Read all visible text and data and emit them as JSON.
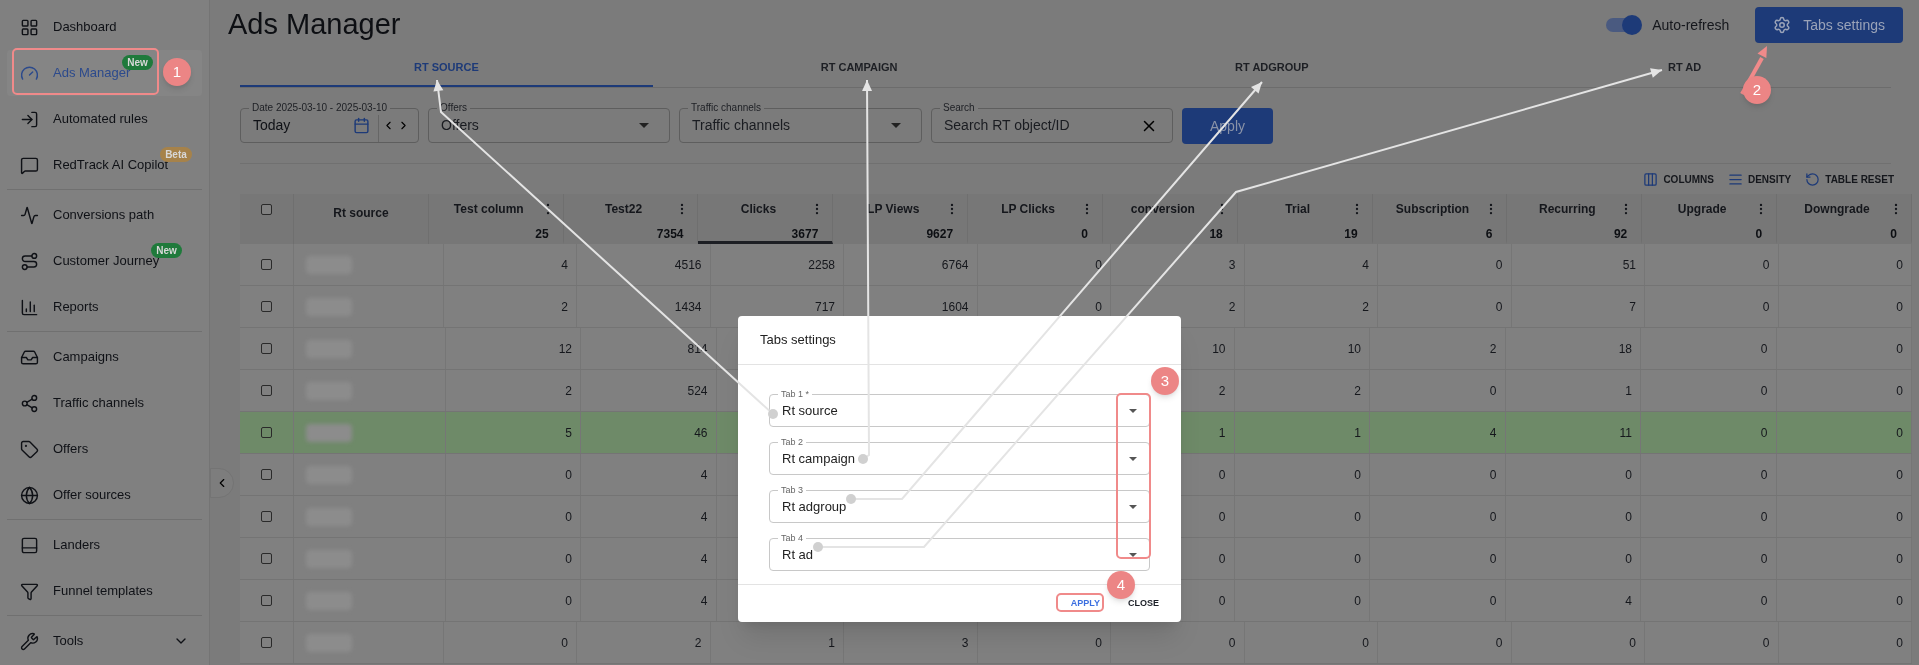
{
  "sidebar": {
    "groups": [
      {
        "items": [
          {
            "label": "Dashboard",
            "selected": false
          },
          {
            "label": "Ads Manager",
            "selected": true,
            "badge": {
              "text": "New",
              "color": "#1f7a3b"
            }
          },
          {
            "label": "Automated rules",
            "selected": false
          },
          {
            "label": "RedTrack AI Copilot",
            "selected": false,
            "badge": {
              "text": "Beta",
              "color": "#a6824a"
            }
          }
        ]
      },
      {
        "items": [
          {
            "label": "Conversions path",
            "selected": false
          },
          {
            "label": "Customer Journey",
            "selected": false,
            "badge": {
              "text": "New",
              "color": "#1f7a3b"
            }
          },
          {
            "label": "Reports",
            "selected": false
          }
        ]
      },
      {
        "items": [
          {
            "label": "Campaigns",
            "selected": false
          },
          {
            "label": "Traffic channels",
            "selected": false
          },
          {
            "label": "Offers",
            "selected": false
          },
          {
            "label": "Offer sources",
            "selected": false
          }
        ]
      },
      {
        "items": [
          {
            "label": "Landers",
            "selected": false
          },
          {
            "label": "Funnel templates",
            "selected": false
          }
        ]
      },
      {
        "items": [
          {
            "label": "Tools",
            "selected": false,
            "expanded": false
          }
        ]
      }
    ]
  },
  "page_title": "Ads Manager",
  "auto_refresh": {
    "label": "Auto-refresh",
    "on": true
  },
  "settings_button": "Tabs settings",
  "tabs": [
    {
      "label": "RT SOURCE",
      "selected": true
    },
    {
      "label": "RT CAMPAIGN",
      "selected": false
    },
    {
      "label": "RT ADGROUP",
      "selected": false
    },
    {
      "label": "RT AD",
      "selected": false
    }
  ],
  "filters": {
    "date": {
      "label": "Date 2025-03-10 - 2025-03-10",
      "value": "Today"
    },
    "offers": {
      "label": "Offers",
      "placeholder": "Offers"
    },
    "traffic_channels": {
      "label": "Traffic channels",
      "placeholder": "Traffic channels"
    },
    "search": {
      "label": "Search",
      "placeholder": "Search RT object/ID"
    },
    "apply": "Apply"
  },
  "toolbar": [
    "COLUMNS",
    "DENSITY",
    "TABLE RESET"
  ],
  "table": {
    "all_checked": false,
    "source_column": {
      "label": "Rt source"
    },
    "columns": [
      {
        "label": "Test column",
        "total": "25",
        "sorted": false
      },
      {
        "label": "Test22",
        "total": "7354",
        "sorted": false
      },
      {
        "label": "Clicks",
        "total": "3677",
        "sorted": true
      },
      {
        "label": "LP Views",
        "total": "9627",
        "sorted": false
      },
      {
        "label": "LP Clicks",
        "total": "0",
        "sorted": false
      },
      {
        "label": "conversion",
        "total": "18",
        "sorted": false
      },
      {
        "label": "Trial",
        "total": "19",
        "sorted": false
      },
      {
        "label": "Subscription",
        "total": "6",
        "sorted": false
      },
      {
        "label": "Recurring",
        "total": "92",
        "sorted": false
      },
      {
        "label": "Upgrade",
        "total": "0",
        "sorted": false
      },
      {
        "label": "Downgrade",
        "total": "0",
        "sorted": false
      }
    ],
    "rows": [
      {
        "checked": false,
        "highlighted": false,
        "cells": [
          "4",
          "4516",
          "2258",
          "6764",
          "0",
          "3",
          "4",
          "0",
          "51",
          "0",
          "0"
        ]
      },
      {
        "checked": false,
        "highlighted": false,
        "cells": [
          "2",
          "1434",
          "717",
          "1604",
          "0",
          "2",
          "2",
          "0",
          "7",
          "0",
          "0"
        ]
      },
      {
        "checked": false,
        "highlighted": false,
        "cells": [
          "12",
          "814",
          null,
          null,
          null,
          "10",
          "10",
          "2",
          "18",
          "0",
          "0"
        ]
      },
      {
        "checked": false,
        "highlighted": false,
        "cells": [
          "2",
          "524",
          null,
          null,
          null,
          "2",
          "2",
          "0",
          "1",
          "0",
          "0"
        ]
      },
      {
        "checked": false,
        "highlighted": true,
        "cells": [
          "5",
          "46",
          null,
          null,
          null,
          "1",
          "1",
          "4",
          "11",
          "0",
          "0"
        ]
      },
      {
        "checked": false,
        "highlighted": false,
        "cells": [
          "0",
          "4",
          null,
          null,
          null,
          "0",
          "0",
          "0",
          "0",
          "0",
          "0"
        ]
      },
      {
        "checked": false,
        "highlighted": false,
        "cells": [
          "0",
          "4",
          null,
          null,
          null,
          "0",
          "0",
          "0",
          "0",
          "0",
          "0"
        ]
      },
      {
        "checked": false,
        "highlighted": false,
        "cells": [
          "0",
          "4",
          null,
          null,
          null,
          "0",
          "0",
          "0",
          "0",
          "0",
          "0"
        ]
      },
      {
        "checked": false,
        "highlighted": false,
        "cells": [
          "0",
          "4",
          null,
          null,
          null,
          "0",
          "0",
          "0",
          "4",
          "0",
          "0"
        ]
      },
      {
        "checked": false,
        "highlighted": false,
        "cells": [
          "0",
          "2",
          "1",
          "3",
          "0",
          "0",
          "0",
          "0",
          "0",
          "0",
          "0"
        ]
      }
    ]
  },
  "dialog": {
    "title": "Tabs settings",
    "fields": [
      {
        "label": "Tab 1 *",
        "value": "Rt source"
      },
      {
        "label": "Tab 2",
        "value": "Rt campaign"
      },
      {
        "label": "Tab 3",
        "value": "Rt adgroup"
      },
      {
        "label": "Tab 4",
        "value": "Rt ad"
      }
    ],
    "buttons": [
      {
        "label": "APPLY",
        "kind": "primary"
      },
      {
        "label": "CLOSE",
        "kind": "secondary"
      }
    ]
  },
  "callouts": [
    "1",
    "2",
    "3",
    "4"
  ]
}
